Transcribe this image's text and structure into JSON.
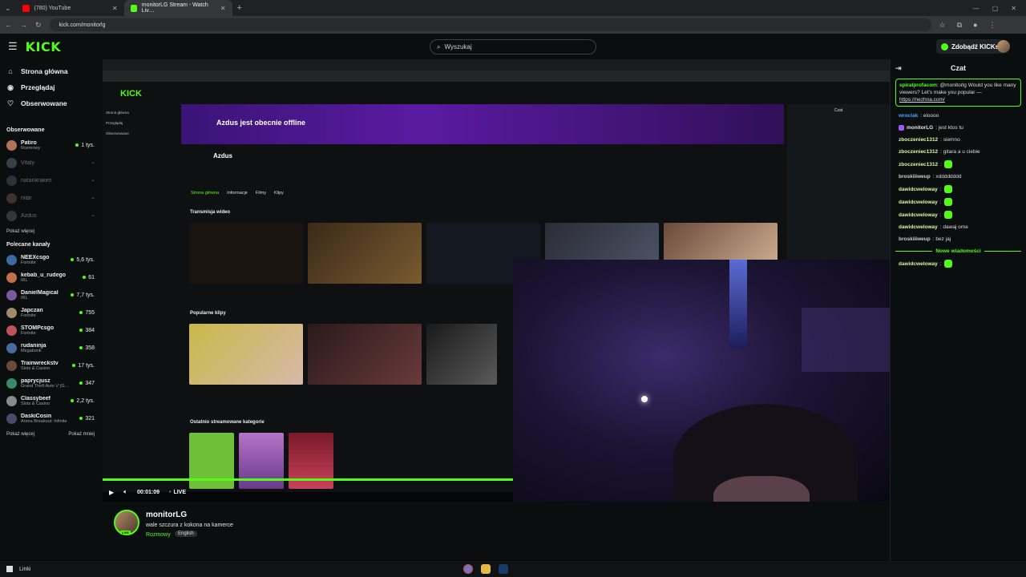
{
  "browser": {
    "tabs": [
      {
        "label": "(780) YouTube",
        "active": false
      },
      {
        "label": "monitorLG Stream - Watch Liv…",
        "active": true
      }
    ],
    "url": "kick.com/monitorlg"
  },
  "header": {
    "logo": "KICK",
    "search_placeholder": "Wyszukaj",
    "kicks_button": "Zdobądź KICKs"
  },
  "sidebar": {
    "nav": [
      {
        "label": "Strona główna",
        "icon": "home-icon"
      },
      {
        "label": "Przeglądaj",
        "icon": "compass-icon"
      },
      {
        "label": "Obserwowane",
        "icon": "heart-icon"
      }
    ],
    "followed_title": "Obserwowane",
    "followed": [
      {
        "name": "Patiro",
        "category": "Rozmowy",
        "viewers": "1 tys.",
        "online": true
      },
      {
        "name": "Vitaly",
        "category": "",
        "viewers": "",
        "online": false
      },
      {
        "name": "natankraken",
        "category": "",
        "viewers": "",
        "online": false
      },
      {
        "name": "nitar",
        "category": "",
        "viewers": "",
        "online": false
      },
      {
        "name": "Azdus",
        "category": "",
        "viewers": "",
        "online": false
      }
    ],
    "followed_show_more": "Pokaż więcej",
    "recommended_title": "Polecane kanały",
    "recommended": [
      {
        "name": "NEEXcsgo",
        "category": "Fortnite",
        "viewers": "5,6 tys."
      },
      {
        "name": "kebab_u_rudego",
        "category": "IRL",
        "viewers": "61"
      },
      {
        "name": "DanielMagical",
        "category": "IRL",
        "viewers": "7,7 tys."
      },
      {
        "name": "Japczan",
        "category": "Fortnite",
        "viewers": "755"
      },
      {
        "name": "STOMPcsgo",
        "category": "Fortnite",
        "viewers": "384"
      },
      {
        "name": "rudaninja",
        "category": "Megabonk",
        "viewers": "358"
      },
      {
        "name": "Trainwreckstv",
        "category": "Slots & Casino",
        "viewers": "17 tys."
      },
      {
        "name": "paprycjusz",
        "category": "Grand Theft Auto V (G…",
        "viewers": "347"
      },
      {
        "name": "Classybeef",
        "category": "Slots & Casino",
        "viewers": "2,2 tys."
      },
      {
        "name": "DaskiCosin",
        "category": "Arena Breakout: Infinite",
        "viewers": "321"
      }
    ],
    "show_more": "Pokaż więcej",
    "show_less": "Pokaż mniej"
  },
  "player": {
    "time": "00:01:09",
    "live_label": "LIVE",
    "inner": {
      "offline_banner": "Azdus jest obecnie offline",
      "channel": "Azdus",
      "tabs": [
        "Strona główna",
        "Informacje",
        "Filmy",
        "Klipy"
      ],
      "section_streams": "Transmisja wideo",
      "section_clips": "Popularne klipy",
      "section_categories": "Ostatnio streamowane kategorie",
      "chat_title": "Czat"
    }
  },
  "stream": {
    "streamer": "monitorLG",
    "title": "wale szczura z kokona na kamerce",
    "category": "Rozmowy",
    "tag": "English",
    "live_badge": "LIVE"
  },
  "chat": {
    "title": "Czat",
    "pinned": {
      "user": "spiralprofacom",
      "text": ": @monitorlg Would you like many viewers? Let's make you popular —",
      "link": "https://nezhna.com/"
    },
    "messages": [
      {
        "user": "wroclak",
        "color": "#4aa3ff",
        "text": ": eloooo",
        "emote": false,
        "badge": false
      },
      {
        "user": "monitorLG",
        "color": "#e6e6e6",
        "text": ": jest ktos tu",
        "emote": false,
        "badge": true
      },
      {
        "user": "zboczeniec1312",
        "color": "#d9f7a8",
        "text": ": siemno",
        "emote": false,
        "badge": false
      },
      {
        "user": "zboczeniec1312",
        "color": "#d9f7a8",
        "text": ": gitara a u ciebie",
        "emote": false,
        "badge": false
      },
      {
        "user": "zboczeniec1312",
        "color": "#d9f7a8",
        "text": ":",
        "emote": true,
        "badge": false
      },
      {
        "user": "broskiiiweup",
        "color": "#cfcfcf",
        "text": ": xdddddddd",
        "emote": false,
        "badge": false
      },
      {
        "user": "dawidcweloway",
        "color": "#d9f7a8",
        "text": ":",
        "emote": true,
        "badge": false
      },
      {
        "user": "dawidcweloway",
        "color": "#d9f7a8",
        "text": ":",
        "emote": true,
        "badge": false
      },
      {
        "user": "dawidcweloway",
        "color": "#d9f7a8",
        "text": ":",
        "emote": true,
        "badge": false
      },
      {
        "user": "dawidcweloway",
        "color": "#d9f7a8",
        "text": ": dawaj ome",
        "emote": false,
        "badge": false
      },
      {
        "user": "broskiiiweup",
        "color": "#cfcfcf",
        "text": ": bez jaj",
        "emote": false,
        "badge": false
      }
    ],
    "new_messages": "Nowe wiadomości",
    "after": [
      {
        "user": "dawidcweloway",
        "color": "#d9f7a8",
        "text": ":",
        "emote": true,
        "badge": false
      }
    ]
  },
  "taskbar": {
    "label": "Linki"
  }
}
